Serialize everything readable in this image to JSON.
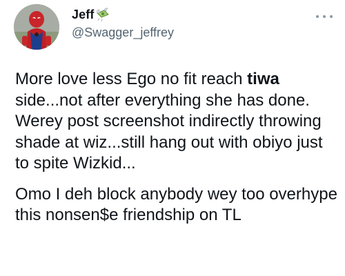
{
  "author": {
    "display_name": "Jeff",
    "name_emoji": "money-with-wings-icon",
    "handle": "@Swagger_jeffrey"
  },
  "tweet": {
    "p1_before": "More love less Ego no fit reach ",
    "p1_bold": "tiwa",
    "p1_after": " side...not after everything she has done.  Werey post screenshot indirectly throwing shade at wiz...still hang out with obiyo just to spite Wizkid...",
    "p2": "Omo I deh block anybody wey too overhype this nonsen$e friendship on TL"
  },
  "icons": {
    "more": "more-options-icon",
    "avatar": "avatar"
  }
}
